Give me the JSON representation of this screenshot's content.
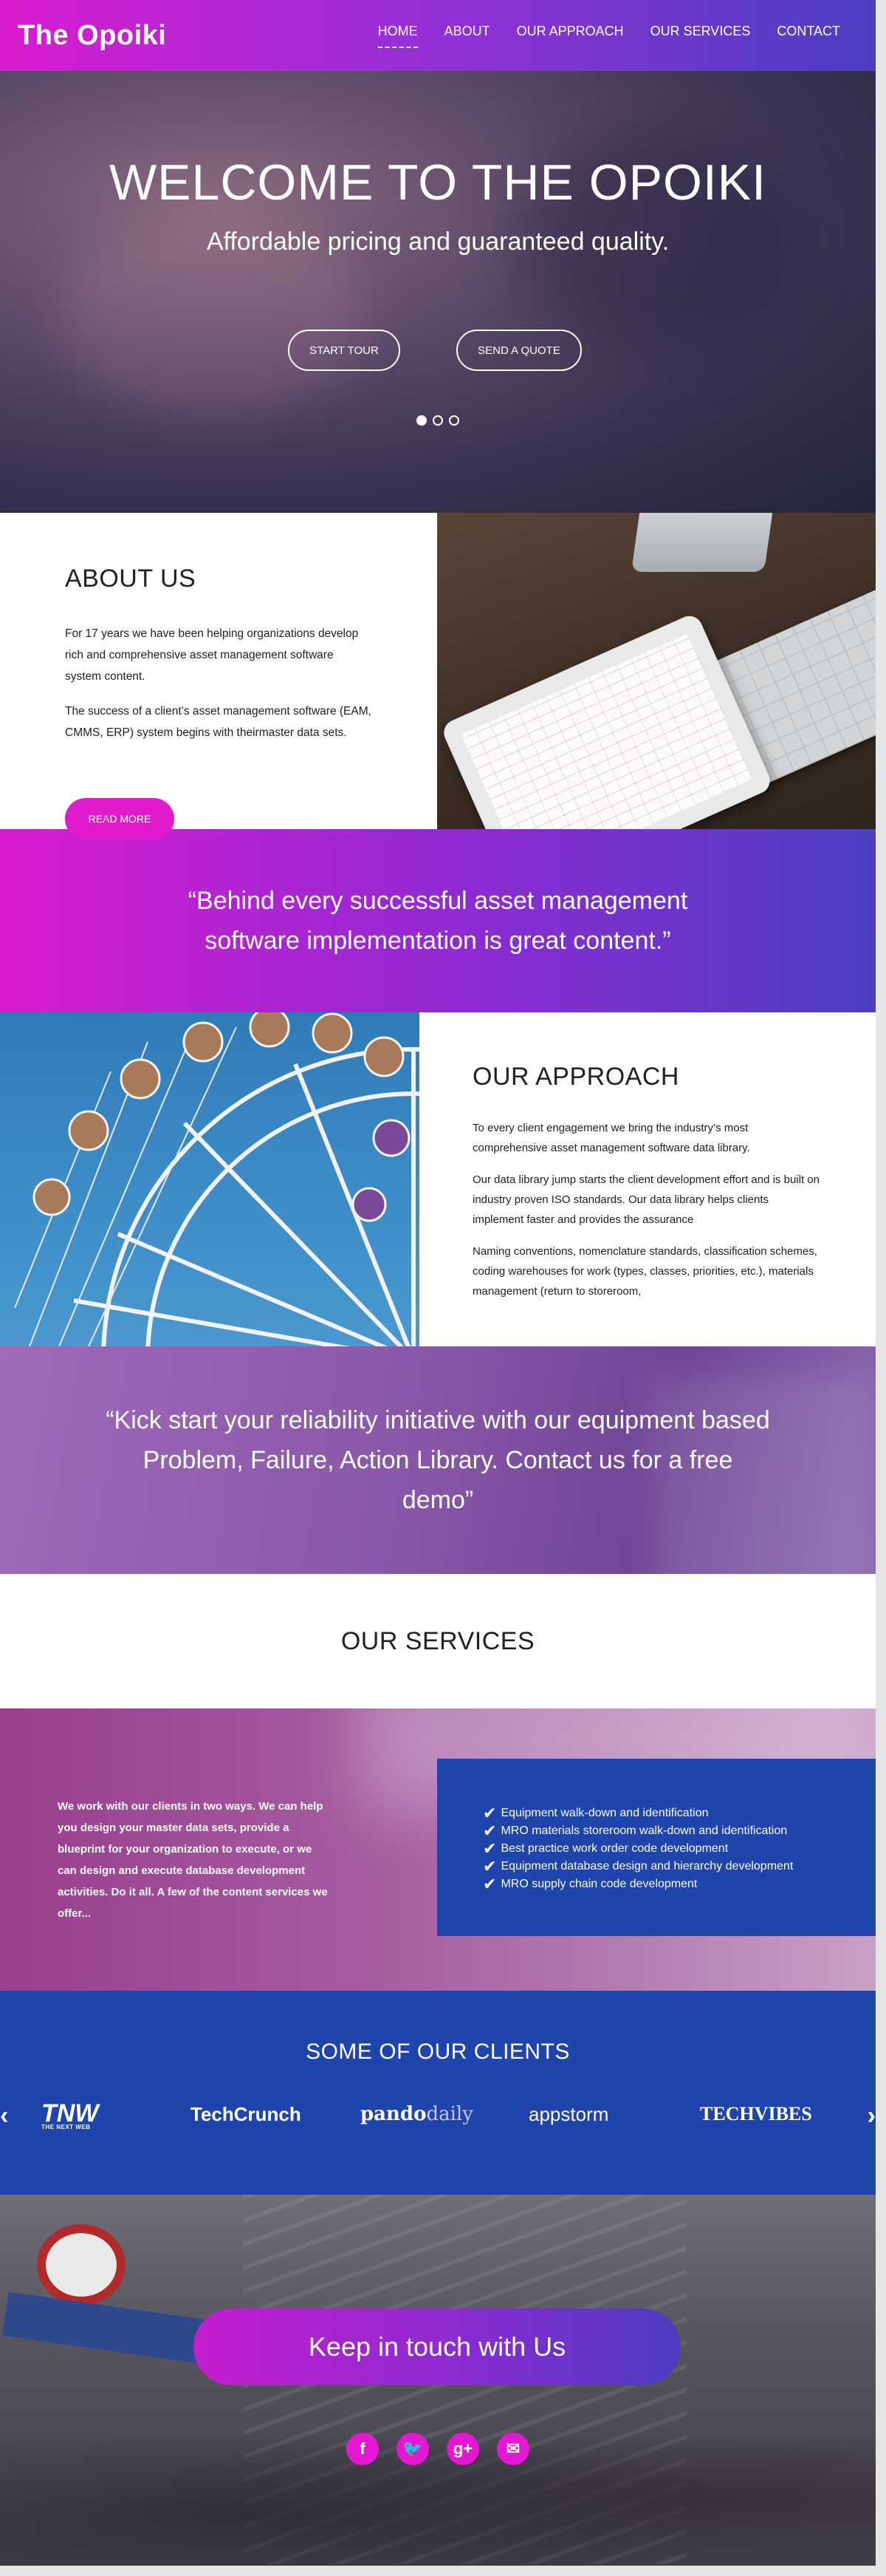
{
  "brand": "The Opoiki",
  "nav": [
    {
      "label": "HOME",
      "active": true
    },
    {
      "label": "ABOUT"
    },
    {
      "label": "OUR APPROACH"
    },
    {
      "label": "OUR SERVICES"
    },
    {
      "label": "CONTACT"
    }
  ],
  "hero": {
    "title": "WELCOME TO THE OPOIKI",
    "subtitle": "Affordable pricing and guaranteed quality.",
    "start_tour": "START TOUR",
    "send_quote": "SEND A QUOTE",
    "slides": 3,
    "active_slide": 1
  },
  "about": {
    "heading": "ABOUT US",
    "p1": "For 17 years we have been helping organizations develop rich and comprehensive asset management software system content.",
    "p2": "The success of a client’s asset management software (EAM, CMMS, ERP) system begins with theirmaster data sets.",
    "read_more": "READ MORE"
  },
  "quote1": "“Behind every successful asset management software implementation is great content.”",
  "approach": {
    "heading": "OUR APPROACH",
    "p1": "To every client engagement we bring the industry’s most comprehensive asset management software data library.",
    "p2": "Our data library jump starts the client development effort and is built on industry proven ISO standards. Our data library helps clients implement faster and provides the assurance",
    "p3": "Naming conventions, nomenclature standards, classification schemes, coding warehouses for work (types, classes, priorities, etc.), materials management (return to storeroom,"
  },
  "quote2": "“Kick start your reliability initiative with our equipment based Problem, Failure, Action Library. Contact us for a free demo”",
  "services": {
    "heading": "OUR SERVICES",
    "intro": "We work with our clients in two ways. We can help you design your master data sets, provide a blueprint for your organization to execute, or we can design and execute database development activities. Do it all. A few of the content services we offer...",
    "items": [
      "Equipment walk-down and identification",
      "MRO materials storeroom walk-down and identification",
      "Best practice work order code development",
      "Equipment database design and hierarchy development",
      "MRO supply chain code development"
    ]
  },
  "clients": {
    "heading": "SOME OF OUR CLIENTS",
    "tnw": "TNW",
    "tnw_sub": "THE NEXT WEB",
    "techcrunch": "TechCrunch",
    "pando_a": "pando",
    "pando_b": "daily",
    "appstorm": "appstorm",
    "techvibes": "TECHVIBES"
  },
  "contact": {
    "keep_in_touch": "Keep in touch with Us",
    "socials": [
      {
        "name": "facebook-icon",
        "glyph": "f"
      },
      {
        "name": "twitter-icon",
        "glyph": "🐦"
      },
      {
        "name": "google-plus-icon",
        "glyph": "g+"
      },
      {
        "name": "email-icon",
        "glyph": "✉"
      }
    ]
  },
  "colors": {
    "brand_pink": "#e01bce",
    "brand_purple": "#4a3fc0",
    "services_blue": "#1f45ad"
  }
}
